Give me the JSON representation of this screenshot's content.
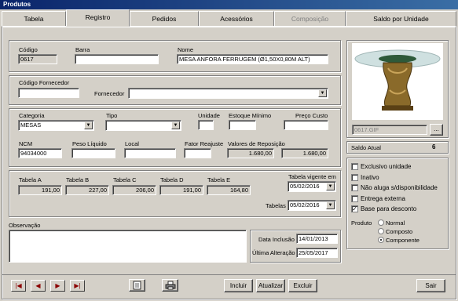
{
  "window": {
    "title": "Produtos"
  },
  "tabs": [
    "Tabela",
    "Registro",
    "Pedidos",
    "Acessórios",
    "Composição",
    "Saldo por Unidade"
  ],
  "registro": {
    "codigo_label": "Código",
    "codigo": "0617",
    "barra_label": "Barra",
    "barra": "",
    "nome_label": "Nome",
    "nome": "MESA ANFORA FERRUGEM (Ø1,50X0,80M ALT)",
    "cod_fornecedor_label": "Código Fornecedor",
    "cod_fornecedor": "",
    "fornecedor_label": "Fornecedor",
    "fornecedor": "",
    "categoria_label": "Categoria",
    "categoria": "MESAS",
    "tipo_label": "Tipo",
    "tipo": "",
    "unidade_label": "Unidade",
    "unidade": "",
    "estoque_minimo_label": "Estoque Mínimo",
    "estoque_minimo": "",
    "preco_custo_label": "Preço Custo",
    "preco_custo": "",
    "ncm_label": "NCM",
    "ncm": "94034000",
    "peso_liquido_label": "Peso Líquido",
    "peso_liquido": "",
    "local_label": "Local",
    "local": "",
    "fator_reajuste_label": "Fator Reajuste",
    "fator_reajuste": "",
    "valores_reposicao_label": "Valores de Reposição",
    "reposicao1": "1.680,00",
    "reposicao2": "1.680,00"
  },
  "tabelas": {
    "a_label": "Tabela A",
    "a": "191,00",
    "b_label": "Tabela B",
    "b": "227,00",
    "c_label": "Tabela C",
    "c": "206,00",
    "d_label": "Tabela D",
    "d": "191,00",
    "e_label": "Tabela E",
    "e": "164,80",
    "vigente_label": "Tabela vigente em",
    "vigente": "05/02/2016",
    "tabelas_label": "Tabelas",
    "tabelas_date": "05/02/2016"
  },
  "observacao_label": "Observação",
  "observacao": "",
  "datas": {
    "inclusao_label": "Data Inclusão",
    "inclusao": "14/01/2013",
    "alteracao_label": "Última Alteração",
    "alteracao": "25/05/2017"
  },
  "image": {
    "filename": "0617.GIF",
    "browse": "..."
  },
  "saldo": {
    "label": "Saldo Atual",
    "value": "6"
  },
  "options": [
    {
      "label": "Exclusivo unidade",
      "checked": false
    },
    {
      "label": "Inativo",
      "checked": false
    },
    {
      "label": "Não aluga s/disponibilidade",
      "checked": false
    },
    {
      "label": "Entrega externa",
      "checked": false
    },
    {
      "label": "Base para desconto",
      "checked": true
    }
  ],
  "produto": {
    "label": "Produto",
    "options": [
      "Normal",
      "Composto",
      "Componente"
    ],
    "selected": "Componente"
  },
  "buttons": {
    "incluir": "Incluir",
    "atualizar": "Atualizar",
    "excluir": "Excluir",
    "sair": "Sair"
  }
}
